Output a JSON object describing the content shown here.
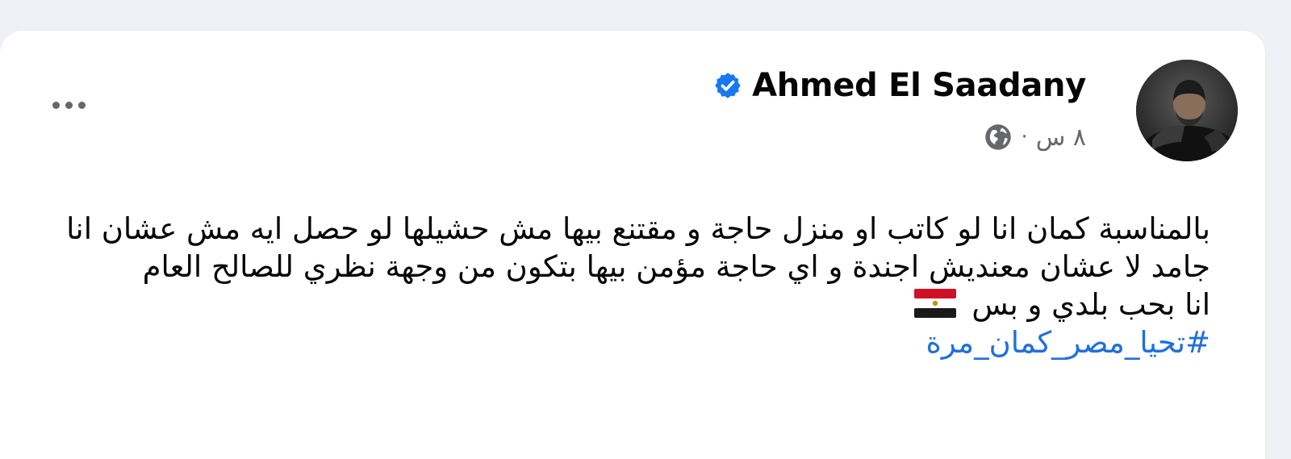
{
  "post": {
    "author": "Ahmed El Saadany",
    "time": "٨ س",
    "separator": "·",
    "lines": [
      "بالمناسبة كمان انا لو كاتب او منزل حاجة و مقتنع بيها مش حشيلها لو حصل ايه مش عشان انا جامد لا عشان معنديش اجندة و اي حاجة مؤمن بيها بتكون من وجهة نظري للصالح العام",
      "انا بحب بلدي و بس"
    ],
    "hashtag": "#تحيا_مصر_كمان_مرة"
  },
  "icons": {
    "verified": "verified-badge-icon",
    "audience": "globe-icon",
    "more": "more-options-icon",
    "flag": "egypt-flag-icon"
  },
  "colors": {
    "background": "#eff1f6",
    "card": "#ffffff",
    "text": "#050505",
    "secondary": "#65676b",
    "link": "#216fdb",
    "verified": "#1877f2"
  }
}
